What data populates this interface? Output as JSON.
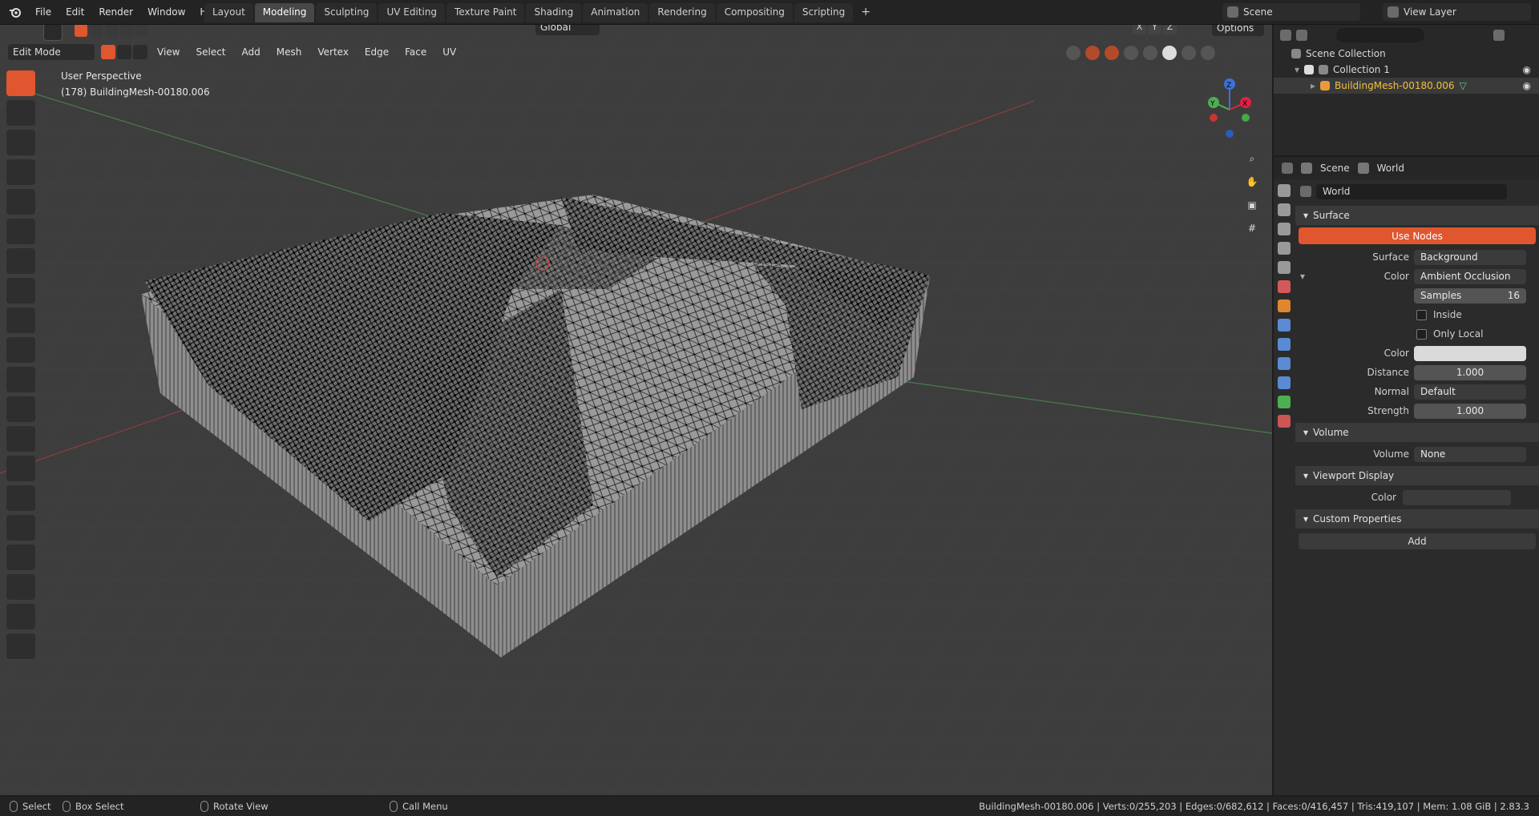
{
  "topbar": {
    "menus": [
      "File",
      "Edit",
      "Render",
      "Window",
      "Help"
    ],
    "workspaces": [
      {
        "label": "Layout",
        "active": false
      },
      {
        "label": "Modeling",
        "active": true
      },
      {
        "label": "Sculpting",
        "active": false
      },
      {
        "label": "UV Editing",
        "active": false
      },
      {
        "label": "Texture Paint",
        "active": false
      },
      {
        "label": "Shading",
        "active": false
      },
      {
        "label": "Animation",
        "active": false
      },
      {
        "label": "Rendering",
        "active": false
      },
      {
        "label": "Compositing",
        "active": false
      },
      {
        "label": "Scripting",
        "active": false
      }
    ],
    "add_workspace": "+",
    "scene": "Scene",
    "view_layer": "View Layer"
  },
  "viewport": {
    "mode": "Edit Mode",
    "menus": [
      "View",
      "Select",
      "Add",
      "Mesh",
      "Vertex",
      "Edge",
      "Face",
      "UV"
    ],
    "orientation": "Global",
    "options_label": "Options",
    "axes": [
      "X",
      "Y",
      "Z"
    ],
    "perspective_label": "User Perspective",
    "object_label": "(178) BuildingMesh-00180.006",
    "gizmo_axes": [
      "Z",
      "Y",
      "X"
    ]
  },
  "outliner": {
    "root": "Scene Collection",
    "collection": "Collection 1",
    "object": "BuildingMesh-00180.006"
  },
  "properties": {
    "breadcrumb": [
      "Scene",
      "World"
    ],
    "world_name": "World",
    "surface_panel": "Surface",
    "use_nodes": "Use Nodes",
    "fields": {
      "surface_label": "Surface",
      "surface_value": "Background",
      "color_label": "Color",
      "color_value": "Ambient Occlusion",
      "samples_label": "Samples",
      "samples_value": "16",
      "inside_label": "Inside",
      "only_local_label": "Only Local",
      "color2_label": "Color",
      "distance_label": "Distance",
      "distance_value": "1.000",
      "normal_label": "Normal",
      "normal_value": "Default",
      "strength_label": "Strength",
      "strength_value": "1.000"
    },
    "volume_panel": "Volume",
    "volume_label": "Volume",
    "volume_value": "None",
    "viewport_display_panel": "Viewport Display",
    "vd_color_label": "Color",
    "custom_props_panel": "Custom Properties",
    "add_label": "Add"
  },
  "status": {
    "select": "Select",
    "box_select": "Box Select",
    "rotate_view": "Rotate View",
    "call_menu": "Call Menu",
    "stats": "BuildingMesh-00180.006 | Verts:0/255,203 | Edges:0/682,612 | Faces:0/416,457 | Tris:419,107 | Mem: 1.08 GiB | 2.83.3"
  },
  "colors": {
    "accent": "#e0562e",
    "viewport_bg": "#3d3d3d",
    "panel_bg": "#2b2b2b"
  }
}
